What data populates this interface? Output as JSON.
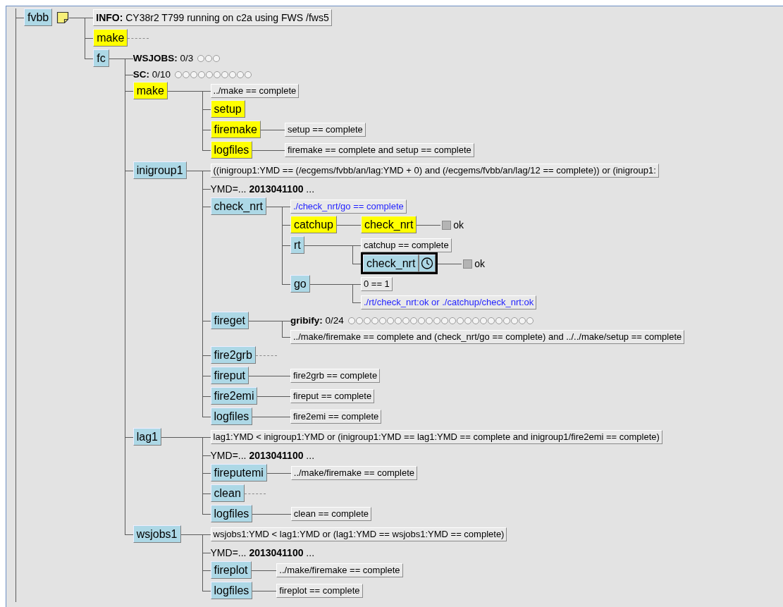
{
  "tree": {
    "kind": "node",
    "name": "fvbb",
    "complete": false,
    "selected": false,
    "note": true,
    "children": [
      {
        "kind": "info",
        "text": "**INFO:** CY38r2 T799 running on c2a using FWS /fws5"
      },
      {
        "kind": "node",
        "name": "make",
        "complete": true,
        "selected": false,
        "collapsed": true
      },
      {
        "kind": "node",
        "name": "fc",
        "complete": false,
        "selected": false,
        "children": [
          {
            "kind": "limit",
            "text": "**WSJOBS:** 0/3",
            "slots": [
              {
                "used": false
              },
              {
                "used": false
              },
              {
                "used": false
              }
            ]
          },
          {
            "kind": "limit",
            "text": "**SC:** 0/10",
            "slots": [
              {
                "used": false
              },
              {
                "used": false
              },
              {
                "used": false
              },
              {
                "used": false
              },
              {
                "used": false
              },
              {
                "used": false
              },
              {
                "used": false
              },
              {
                "used": false
              },
              {
                "used": false
              },
              {
                "used": false
              }
            ]
          },
          {
            "kind": "node",
            "name": "make",
            "complete": true,
            "selected": false,
            "children": [
              {
                "kind": "trigger",
                "text": "../make == complete"
              },
              {
                "kind": "node",
                "name": "setup",
                "complete": true,
                "selected": false
              },
              {
                "kind": "node",
                "name": "firemake",
                "complete": true,
                "selected": false,
                "children": [
                  {
                    "kind": "trigger",
                    "text": "setup == complete"
                  }
                ]
              },
              {
                "kind": "node",
                "name": "logfiles",
                "complete": true,
                "selected": false,
                "children": [
                  {
                    "kind": "trigger",
                    "text": "firemake == complete and setup == complete"
                  }
                ]
              }
            ]
          },
          {
            "kind": "node",
            "name": "inigroup1",
            "complete": false,
            "selected": false,
            "children": [
              {
                "kind": "trigger",
                "text": "((inigroup1:YMD == (/ecgems/fvbb/an/lag:YMD + 0) and (/ecgems/fvbb/an/lag/12 == complete)) or (inigroup1:"
              },
              {
                "kind": "variable",
                "text": "YMD=... **2013041100** ..."
              },
              {
                "kind": "node",
                "name": "check_nrt",
                "complete": false,
                "selected": false,
                "children": [
                  {
                    "kind": "complete",
                    "text": "./check_nrt/go == complete"
                  },
                  {
                    "kind": "node",
                    "name": "catchup",
                    "complete": true,
                    "selected": false,
                    "children": [
                      {
                        "kind": "node",
                        "name": "check_nrt",
                        "complete": true,
                        "selected": false,
                        "children": [
                          {
                            "kind": "event",
                            "name": "ok",
                            "set": false
                          }
                        ]
                      }
                    ]
                  },
                  {
                    "kind": "node",
                    "name": "rt",
                    "complete": false,
                    "selected": false,
                    "children": [
                      {
                        "kind": "trigger",
                        "text": "catchup == complete"
                      },
                      {
                        "kind": "node",
                        "name": "check_nrt",
                        "complete": false,
                        "selected": true,
                        "clock": true,
                        "children": [
                          {
                            "kind": "event",
                            "name": "ok",
                            "set": false
                          }
                        ]
                      }
                    ]
                  },
                  {
                    "kind": "node",
                    "name": "go",
                    "complete": false,
                    "selected": false,
                    "children": [
                      {
                        "kind": "trigger",
                        "text": "0 == 1"
                      },
                      {
                        "kind": "complete",
                        "text": "./rt/check_nrt:ok or ./catchup/check_nrt:ok"
                      }
                    ]
                  }
                ]
              },
              {
                "kind": "node",
                "name": "fireget",
                "complete": false,
                "selected": false,
                "children": [
                  {
                    "kind": "limit",
                    "text": "**gribify:** 0/24",
                    "slots": [
                      {
                        "used": false
                      },
                      {
                        "used": false
                      },
                      {
                        "used": false
                      },
                      {
                        "used": false
                      },
                      {
                        "used": false
                      },
                      {
                        "used": false
                      },
                      {
                        "used": false
                      },
                      {
                        "used": false
                      },
                      {
                        "used": false
                      },
                      {
                        "used": false
                      },
                      {
                        "used": false
                      },
                      {
                        "used": false
                      },
                      {
                        "used": false
                      },
                      {
                        "used": false
                      },
                      {
                        "used": false
                      },
                      {
                        "used": false
                      },
                      {
                        "used": false
                      },
                      {
                        "used": false
                      },
                      {
                        "used": false
                      },
                      {
                        "used": false
                      },
                      {
                        "used": false
                      },
                      {
                        "used": false
                      },
                      {
                        "used": false
                      },
                      {
                        "used": false
                      }
                    ]
                  },
                  {
                    "kind": "trigger",
                    "text": "../make/firemake == complete and (check_nrt/go == complete) and ../../make/setup == complete"
                  }
                ]
              },
              {
                "kind": "node",
                "name": "fire2grb",
                "complete": false,
                "selected": false,
                "collapsed": true
              },
              {
                "kind": "node",
                "name": "fireput",
                "complete": false,
                "selected": false,
                "children": [
                  {
                    "kind": "trigger",
                    "text": "fire2grb == complete"
                  }
                ]
              },
              {
                "kind": "node",
                "name": "fire2emi",
                "complete": false,
                "selected": false,
                "children": [
                  {
                    "kind": "trigger",
                    "text": "fireput == complete"
                  }
                ]
              },
              {
                "kind": "node",
                "name": "logfiles",
                "complete": false,
                "selected": false,
                "children": [
                  {
                    "kind": "trigger",
                    "text": "fire2emi == complete"
                  }
                ]
              }
            ]
          },
          {
            "kind": "node",
            "name": "lag1",
            "complete": false,
            "selected": false,
            "children": [
              {
                "kind": "trigger",
                "text": "lag1:YMD < inigroup1:YMD or (inigroup1:YMD == lag1:YMD == complete and inigroup1/fire2emi == complete)"
              },
              {
                "kind": "variable",
                "text": "YMD=... **2013041100** ..."
              },
              {
                "kind": "node",
                "name": "fireputemi",
                "complete": false,
                "selected": false,
                "children": [
                  {
                    "kind": "trigger",
                    "text": "../make/firemake == complete"
                  }
                ]
              },
              {
                "kind": "node",
                "name": "clean",
                "complete": false,
                "selected": false,
                "collapsed": true
              },
              {
                "kind": "node",
                "name": "logfiles",
                "complete": false,
                "selected": false,
                "children": [
                  {
                    "kind": "trigger",
                    "text": "clean == complete"
                  }
                ]
              }
            ]
          },
          {
            "kind": "node",
            "name": "wsjobs1",
            "complete": false,
            "selected": false,
            "children": [
              {
                "kind": "trigger",
                "text": "wsjobs1:YMD < lag1:YMD or (lag1:YMD == wsjobs1:YMD == complete)"
              },
              {
                "kind": "variable",
                "text": "YMD=... **2013041100** ..."
              },
              {
                "kind": "node",
                "name": "fireplot",
                "complete": false,
                "selected": false,
                "children": [
                  {
                    "kind": "trigger",
                    "text": "../make/firemake == complete"
                  }
                ]
              },
              {
                "kind": "node",
                "name": "logfiles",
                "complete": false,
                "selected": false,
                "children": [
                  {
                    "kind": "trigger",
                    "text": "fireplot == complete"
                  }
                ]
              }
            ]
          }
        ]
      }
    ]
  }
}
